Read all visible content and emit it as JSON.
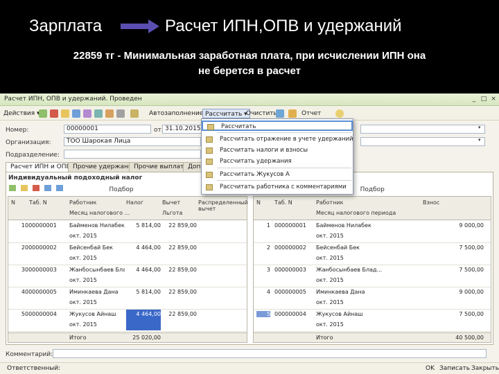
{
  "slide": {
    "left_title": "Зарплата",
    "right_title": "Расчет ИПН,ОПВ и удержаний",
    "subtitle_line1": "22859 тг - Минимальная заработная плата, при исчислении ИПН она",
    "subtitle_line2": "не берется в расчет",
    "arrow_color": "#5a4fb0"
  },
  "window": {
    "title": "Расчет ИПН, ОПВ и удержаний. Проведен",
    "toolbar": {
      "actions": "Действия ▾",
      "calculate": "Рассчитать ▾",
      "autofill": "Автозаполнение ▾",
      "clear": "Очистить",
      "report": "Отчет"
    },
    "fields": {
      "number_label": "Номер:",
      "number_value": "00000001",
      "from_label": "от:",
      "from_value": "31.10.2015",
      "org_label": "Организация:",
      "org_value": "ТОО Шарокая Лица",
      "dept_label": "Подразделение:",
      "dept_value": ""
    },
    "tabs": [
      "Расчет ИПН и ОПВ",
      "Прочие удержания",
      "Прочие выплаты",
      "Доп"
    ],
    "left_grid": {
      "section_title": "Индивидуальный подоходный налог",
      "pick": "Подбор",
      "headers": {
        "n": "N",
        "tab": "Таб. N",
        "worker": "Работник",
        "period": "Месяц налогового ...",
        "tax": "Налог",
        "deduct": "Вычет",
        "benefit": "Льгота",
        "dist": "Распределенный вычет"
      },
      "rows": [
        {
          "n": "1",
          "tab": "000000001",
          "worker": "Байменов Нилабек",
          "period": "окт. 2015",
          "tax": "5 814,00",
          "deduct": "22 859,00"
        },
        {
          "n": "2",
          "tab": "000000002",
          "worker": "Бейсенбай Бек",
          "period": "окт. 2015",
          "tax": "4 464,00",
          "deduct": "22 859,00"
        },
        {
          "n": "3",
          "tab": "000000003",
          "worker": "Жанбосынбаев Блад...",
          "period": "окт. 2015",
          "tax": "4 464,00",
          "deduct": "22 859,00"
        },
        {
          "n": "4",
          "tab": "000000005",
          "worker": "Иминкаева Дана",
          "period": "окт. 2015",
          "tax": "5 814,00",
          "deduct": "22 859,00"
        },
        {
          "n": "5",
          "tab": "000000004",
          "worker": "Жукусов Айнаш",
          "period": "окт. 2015",
          "tax": "4 464,00",
          "deduct": "22 859,00"
        }
      ],
      "footer_label": "Итого",
      "footer_value": "25 020,00"
    },
    "right_grid": {
      "pick": "Подбор",
      "headers": {
        "n": "N",
        "tab": "Таб. N",
        "worker": "Работник",
        "period": "Месяц налогового периода",
        "amount": "Взнос"
      },
      "rows": [
        {
          "n": "1",
          "tab": "000000001",
          "worker": "Байменов Нилабек",
          "period": "окт. 2015",
          "amount": "9 000,00"
        },
        {
          "n": "2",
          "tab": "000000002",
          "worker": "Бейсенбай Бек",
          "period": "окт. 2015",
          "amount": "7 500,00"
        },
        {
          "n": "3",
          "tab": "000000003",
          "worker": "Жанбосынбаев Блад...",
          "period": "окт. 2015",
          "amount": "7 500,00"
        },
        {
          "n": "4",
          "tab": "000000005",
          "worker": "Иминкаева Дана",
          "period": "окт. 2015",
          "amount": "9 000,00"
        },
        {
          "n": "5",
          "tab": "000000004",
          "worker": "Жукусов Айнаш",
          "period": "окт. 2015",
          "amount": "7 500,00"
        }
      ],
      "footer_label": "Итого",
      "footer_value": "40 500,00"
    },
    "menu": {
      "items": [
        "Рассчитать",
        "Рассчитать отражение в учете удержаний",
        "Рассчитать налоги и взносы",
        "Рассчитать удержания",
        "Рассчитать Жукусов А",
        "Рассчитать работника с комментариями"
      ]
    },
    "comment_label": "Комментарий:",
    "responsible_label": "Ответственный:",
    "status": {
      "ok": "OK",
      "save": "Записать",
      "close": "Закрыть"
    }
  }
}
